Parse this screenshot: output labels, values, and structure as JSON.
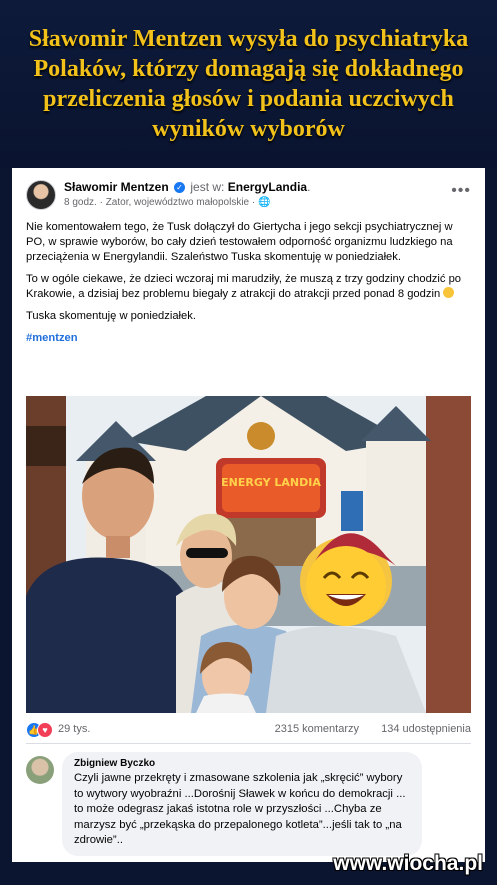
{
  "headline": "Sławomir Mentzen wysyła do psychiatryka Polaków, którzy domagają się dokładnego przeliczenia głosów i podania uczciwych wyników wyborów",
  "post": {
    "author": "Sławomir Mentzen",
    "is_at": "jest w:",
    "location": "EnergyLandia",
    "time": "8 godz.",
    "place_detail": "Zator, województwo małopolskie",
    "more_label": "•••",
    "paragraphs": [
      "Nie komentowałem tego, że Tusk dołączył do Giertycha i jego sekcji psychiatrycznej w PO, w sprawie wyborów, bo cały dzień testowałem odporność organizmu ludzkiego na przeciążenia w Energylandii. Szaleństwo Tuska skomentuję w poniedziałek.",
      "To w ogóle ciekawe, że dzieci wczoraj mi marudziły, że muszą z trzy godziny chodzić po Krakowie, a dzisiaj bez problemu biegały z atrakcji do atrakcji przed ponad 8 godzin",
      "Tuska skomentuję w poniedziałek."
    ],
    "hashtag": "#mentzen",
    "photo_sign": "ENERGY LANDIA",
    "reactions_count": "29 tys.",
    "comments_count": "2315 komentarzy",
    "shares_count": "134 udostępnienia"
  },
  "comment": {
    "author": "Zbigniew Byczko",
    "text": "Czyli jawne przekręty i zmasowane szkolenia jak „skręcić” wybory to wytwory wyobraźni ...Dorośnij Sławek w końcu do demokracji ... to może odegrasz jakaś istotna role w przyszłości ...Chyba ze marzysz być „przekąska do przepalonego kotleta”...jeśli tak to „na zdrowie”.."
  },
  "watermark": "www.wiocha.pl",
  "colors": {
    "headline": "#f2c21b",
    "background": "#0b1530",
    "link": "#216fdb",
    "like": "#1877f2",
    "love": "#f33e58"
  }
}
